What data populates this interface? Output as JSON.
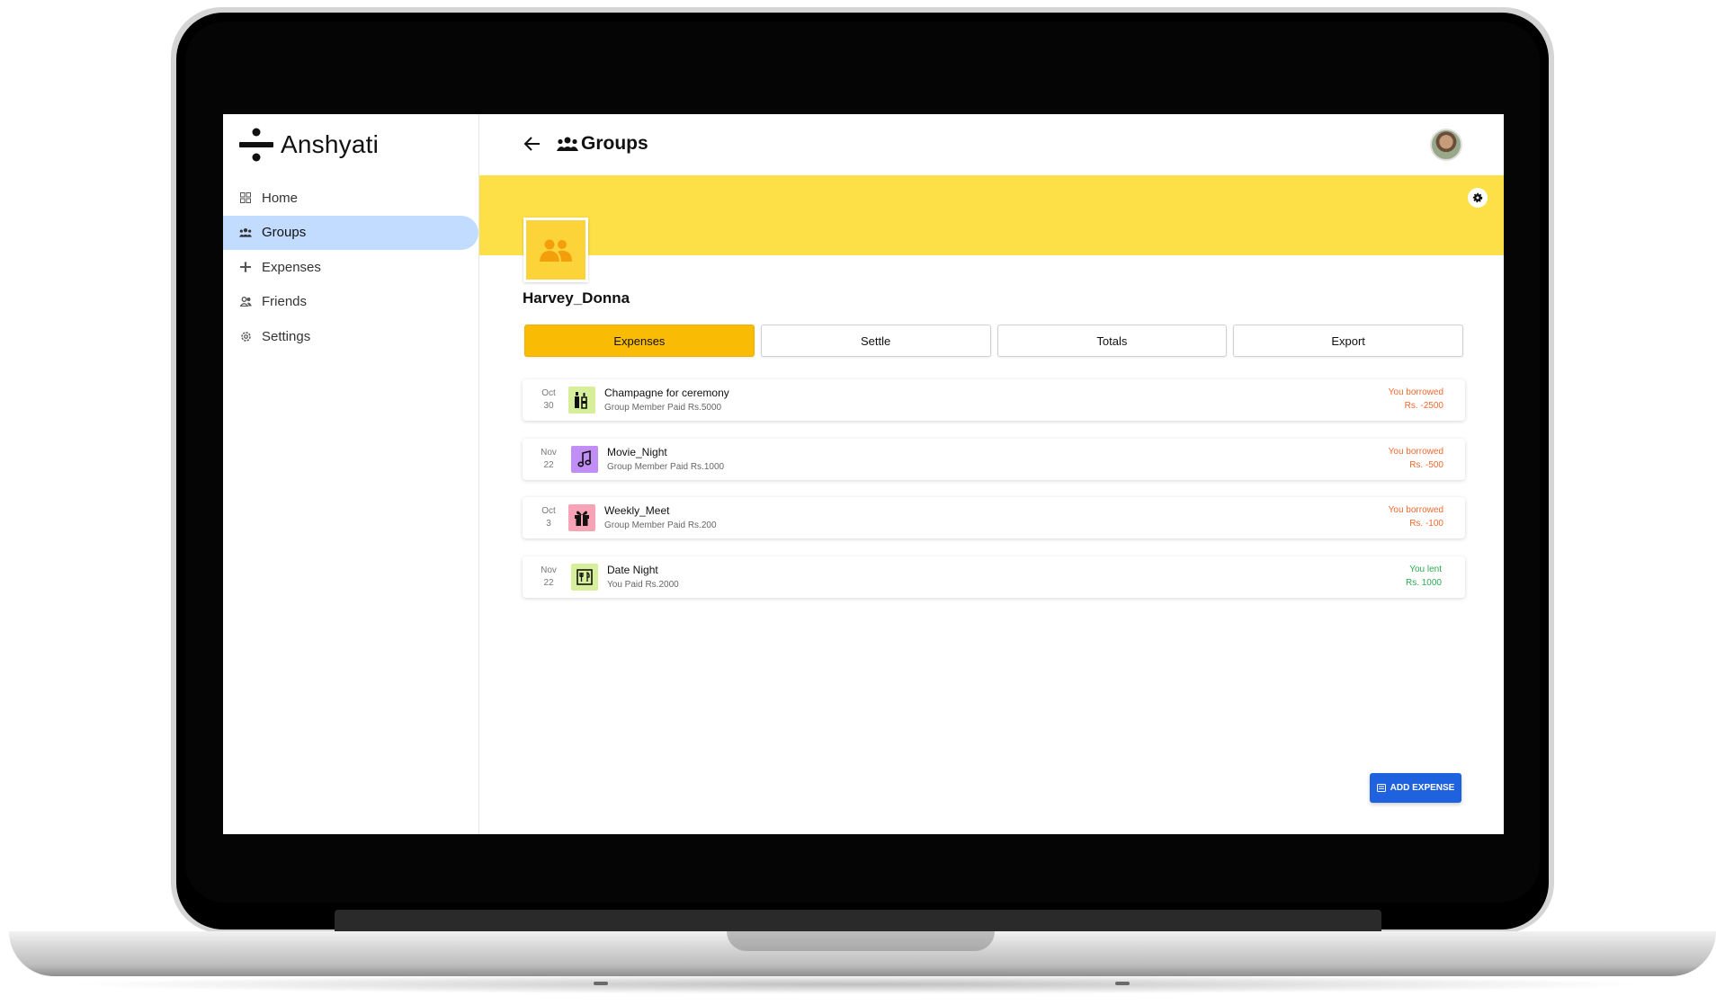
{
  "app": {
    "name": "Anshyati"
  },
  "sidebar": {
    "items": [
      {
        "label": "Home",
        "icon": "dashboard-icon",
        "active": false
      },
      {
        "label": "Groups",
        "icon": "groups-icon",
        "active": true
      },
      {
        "label": "Expenses",
        "icon": "expenses-icon",
        "active": false
      },
      {
        "label": "Friends",
        "icon": "friends-icon",
        "active": false
      },
      {
        "label": "Settings",
        "icon": "settings-icon",
        "active": false
      }
    ]
  },
  "header": {
    "title": "Groups",
    "back_icon": "arrow-left-icon",
    "title_icon": "groups-icon"
  },
  "banner": {
    "color": "#fde047"
  },
  "group": {
    "name": "Harvey_Donna"
  },
  "tabs": [
    {
      "label": "Expenses",
      "active": true
    },
    {
      "label": "Settle",
      "active": false
    },
    {
      "label": "Totals",
      "active": false
    },
    {
      "label": "Export",
      "active": false
    }
  ],
  "expenses": [
    {
      "month": "Oct",
      "day": "30",
      "title": "Champagne for ceremony",
      "subtitle": "Group Member Paid Rs.5000",
      "status": "You borrowed",
      "amount": "Rs. -2500",
      "icon": "bottle-icon",
      "icon_bg": "#d7ef9a",
      "status_color": "#f2692e"
    },
    {
      "month": "Nov",
      "day": "22",
      "title": "Movie_Night",
      "subtitle": "Group Member Paid Rs.1000",
      "status": "You borrowed",
      "amount": "Rs. -500",
      "icon": "music-note-icon",
      "icon_bg": "#c18ef5",
      "status_color": "#f2692e"
    },
    {
      "month": "Oct",
      "day": "3",
      "title": "Weekly_Meet",
      "subtitle": "Group Member Paid Rs.200",
      "status": "You borrowed",
      "amount": "Rs. -100",
      "icon": "gift-icon",
      "icon_bg": "#f7a3b5",
      "status_color": "#f2692e"
    },
    {
      "month": "Nov",
      "day": "22",
      "title": "Date Night",
      "subtitle": "You Paid Rs.2000",
      "status": "You lent",
      "amount": "Rs. 1000",
      "icon": "restaurant-icon",
      "icon_bg": "#d7ef9a",
      "status_color": "#2eaa52"
    }
  ],
  "actions": {
    "add_expense": "ADD EXPENSE"
  },
  "colors": {
    "accent": "#fabb05",
    "primary": "#1f62e0",
    "nav_active": "#c2dcff"
  }
}
